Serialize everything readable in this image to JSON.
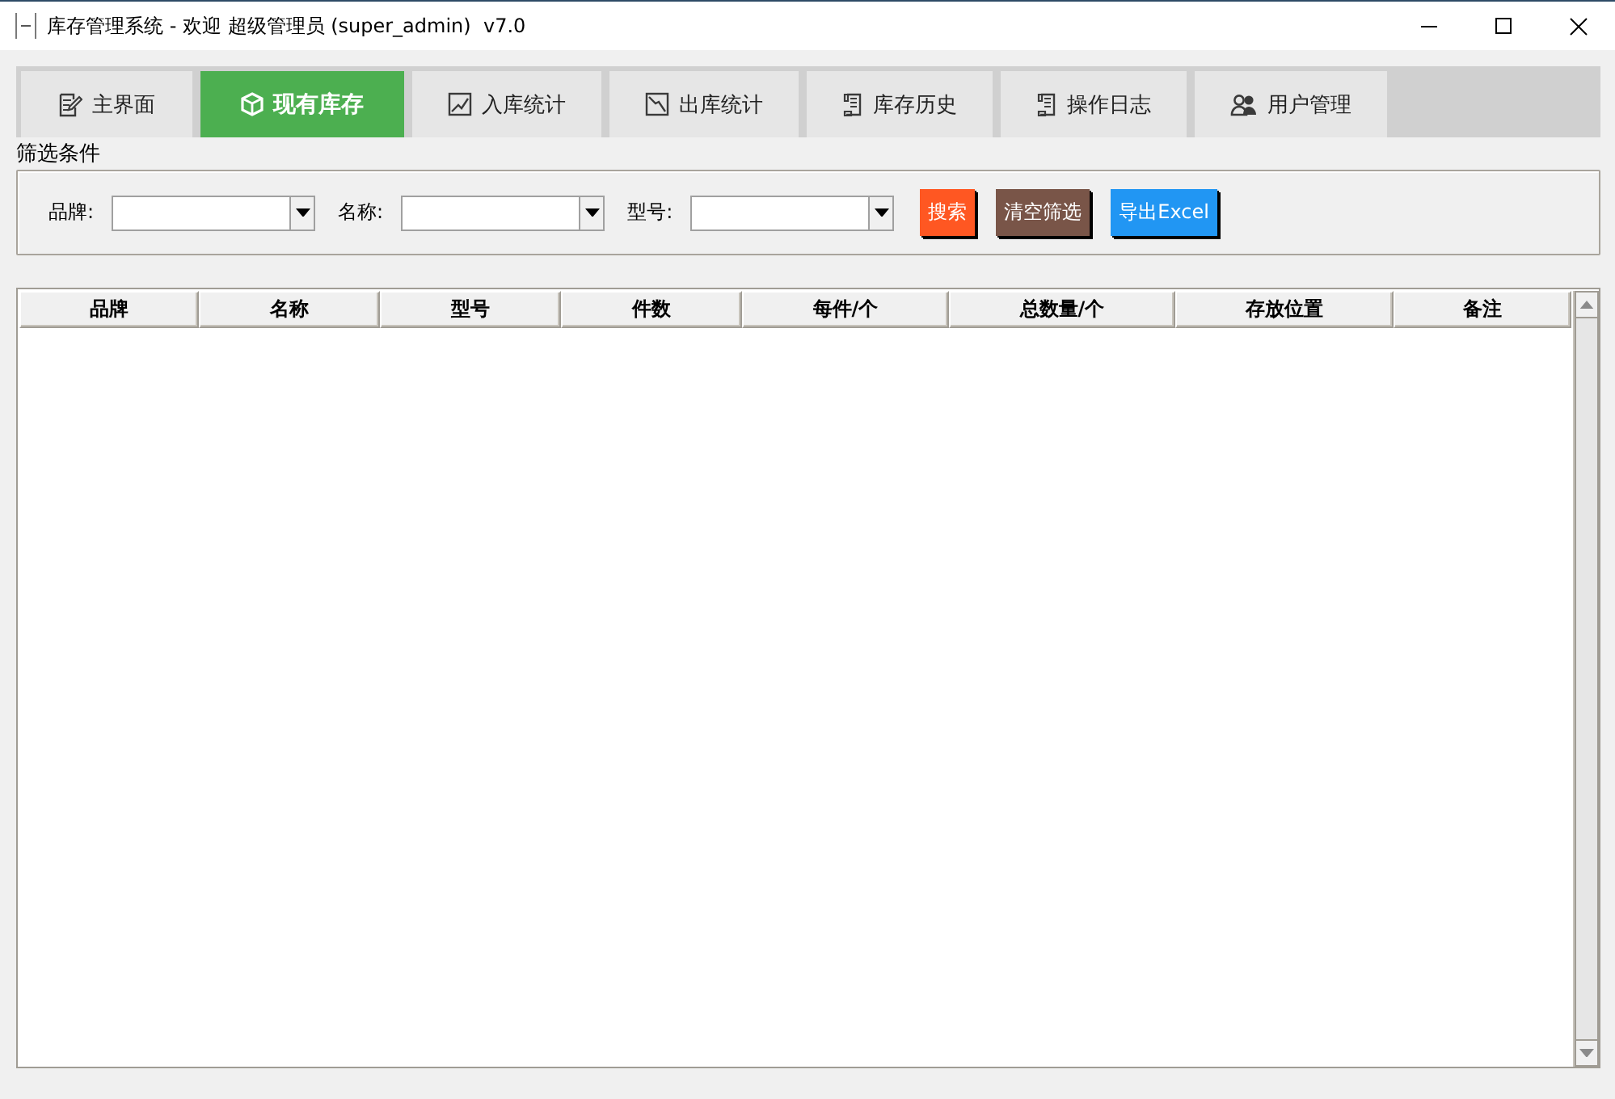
{
  "window": {
    "title": "库存管理系统 - 欢迎 超级管理员 (super_admin)  v7.0"
  },
  "tabs": [
    {
      "label": "主界面",
      "selected": false
    },
    {
      "label": "现有库存",
      "selected": true
    },
    {
      "label": "入库统计",
      "selected": false
    },
    {
      "label": "出库统计",
      "selected": false
    },
    {
      "label": "库存历史",
      "selected": false
    },
    {
      "label": "操作日志",
      "selected": false
    },
    {
      "label": "用户管理",
      "selected": false
    }
  ],
  "filter": {
    "title": "筛选条件",
    "fields": [
      {
        "label": "品牌:"
      },
      {
        "label": "名称:"
      },
      {
        "label": "型号:"
      }
    ],
    "buttons": [
      {
        "label": "搜索",
        "color": "#ff5722"
      },
      {
        "label": "清空筛选",
        "color": "#795548"
      },
      {
        "label": "导出Excel",
        "color": "#2196f3"
      }
    ]
  },
  "table": {
    "columns": [
      "品牌",
      "名称",
      "型号",
      "件数",
      "每件/个",
      "总数量/个",
      "存放位置",
      "备注"
    ]
  }
}
